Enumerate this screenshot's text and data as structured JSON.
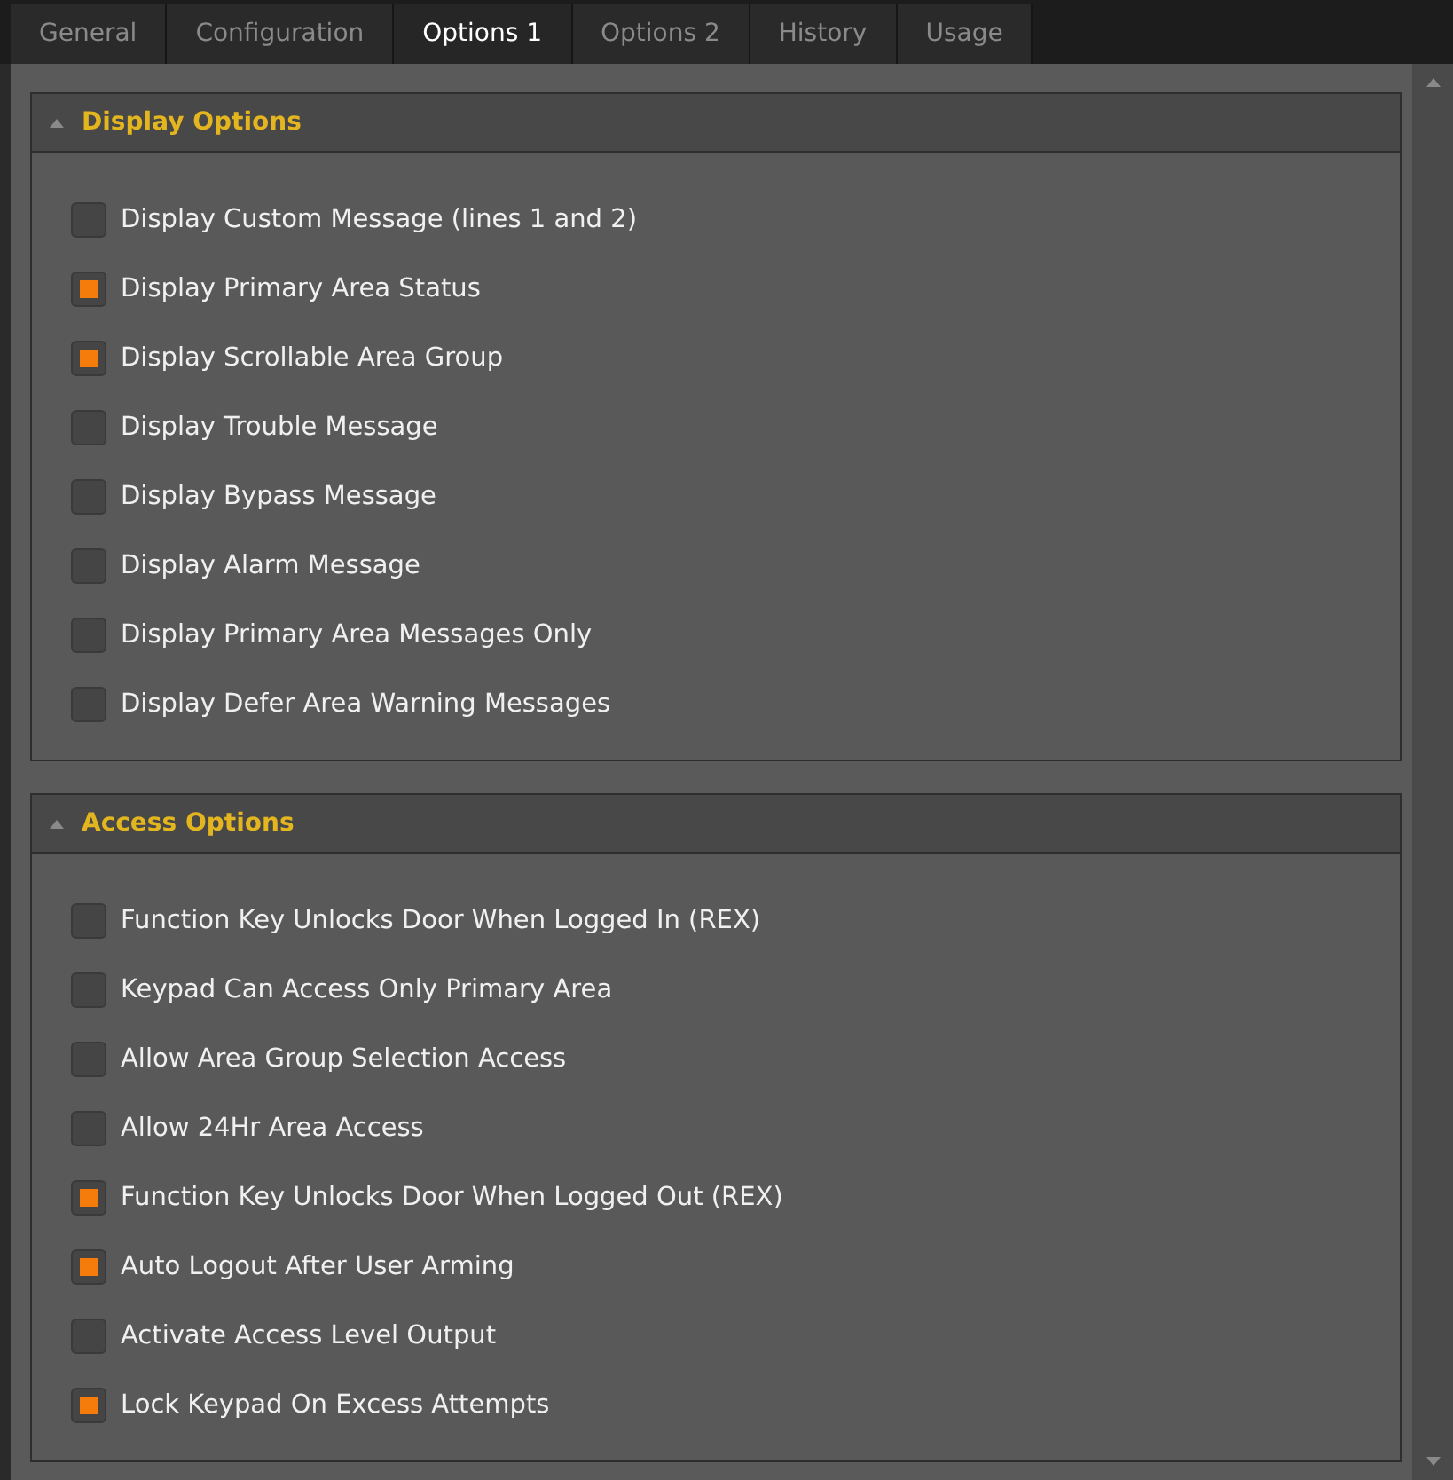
{
  "tabs": [
    {
      "label": "General",
      "selected": false
    },
    {
      "label": "Configuration",
      "selected": false
    },
    {
      "label": "Options 1",
      "selected": true
    },
    {
      "label": "Options 2",
      "selected": false
    },
    {
      "label": "History",
      "selected": false
    },
    {
      "label": "Usage",
      "selected": false
    }
  ],
  "sections": [
    {
      "title": "Display Options",
      "expanded": true,
      "options": [
        {
          "label": "Display Custom Message (lines 1 and 2)",
          "checked": false
        },
        {
          "label": "Display Primary Area Status",
          "checked": true
        },
        {
          "label": "Display Scrollable Area Group",
          "checked": true
        },
        {
          "label": "Display Trouble Message",
          "checked": false
        },
        {
          "label": "Display Bypass Message",
          "checked": false
        },
        {
          "label": "Display Alarm Message",
          "checked": false
        },
        {
          "label": "Display Primary Area Messages Only",
          "checked": false
        },
        {
          "label": "Display Defer Area Warning Messages",
          "checked": false
        }
      ]
    },
    {
      "title": "Access Options",
      "expanded": true,
      "options": [
        {
          "label": "Function Key Unlocks Door When Logged In (REX)",
          "checked": false
        },
        {
          "label": "Keypad Can Access Only Primary Area",
          "checked": false
        },
        {
          "label": "Allow Area Group Selection Access",
          "checked": false
        },
        {
          "label": "Allow 24Hr Area Access",
          "checked": false
        },
        {
          "label": "Function Key Unlocks Door When Logged Out (REX)",
          "checked": true
        },
        {
          "label": "Auto Logout After User Arming",
          "checked": true
        },
        {
          "label": "Activate Access Level Output",
          "checked": false
        },
        {
          "label": "Lock Keypad On Excess Attempts",
          "checked": true
        }
      ]
    }
  ]
}
